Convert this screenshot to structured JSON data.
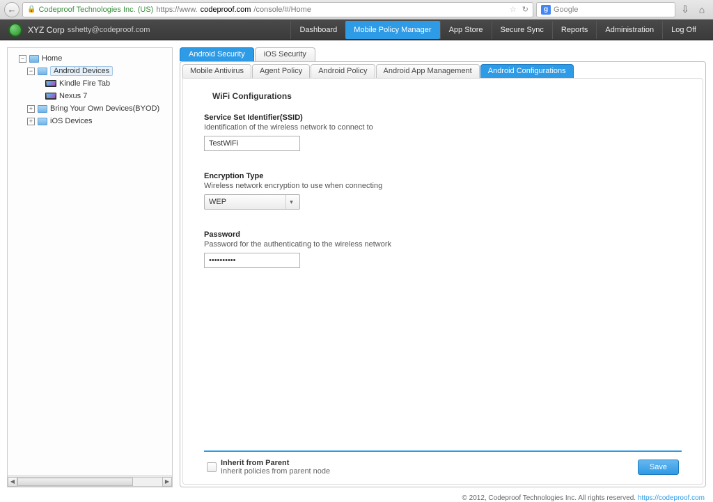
{
  "browser": {
    "site_identity": "Codeproof Technologies Inc. (US)",
    "url_prefix": "https://www.",
    "url_host": "codeproof.com",
    "url_path": "/console/#/Home",
    "search_placeholder": "Google"
  },
  "header": {
    "org": "XYZ Corp",
    "user": "sshetty@codeproof.com",
    "nav": {
      "dashboard": "Dashboard",
      "mpm": "Mobile Policy Manager",
      "appstore": "App Store",
      "securesync": "Secure Sync",
      "reports": "Reports",
      "admin": "Administration",
      "logoff": "Log Off"
    }
  },
  "tree": {
    "home": "Home",
    "android_devices": "Android Devices",
    "kindle": "Kindle Fire Tab",
    "nexus": "Nexus 7",
    "byod": "Bring Your Own Devices(BYOD)",
    "ios_devices": "iOS Devices"
  },
  "topTabs": {
    "android_sec": "Android Security",
    "ios_sec": "iOS Security"
  },
  "subTabs": {
    "antivirus": "Mobile Antivirus",
    "agent": "Agent Policy",
    "android_policy": "Android Policy",
    "app_mgmt": "Android App Management",
    "android_config": "Android Configurations"
  },
  "form": {
    "section_title": "WiFi Configurations",
    "ssid_label": "Service Set Identifier(SSID)",
    "ssid_desc": "Identification of the wireless network to connect to",
    "ssid_value": "TestWiFi",
    "enc_label": "Encryption Type",
    "enc_desc": "Wireless network encryption to use when connecting",
    "enc_value": "WEP",
    "pwd_label": "Password",
    "pwd_desc": "Password for the authenticating to the wireless network",
    "pwd_value": "••••••••••"
  },
  "footerPanel": {
    "inherit_label": "Inherit from Parent",
    "inherit_desc": "Inherit policies from parent node",
    "save": "Save"
  },
  "pageFooter": {
    "text": "© 2012, Codeproof Technologies Inc. All rights reserved. ",
    "link": "https://codeproof.com"
  }
}
